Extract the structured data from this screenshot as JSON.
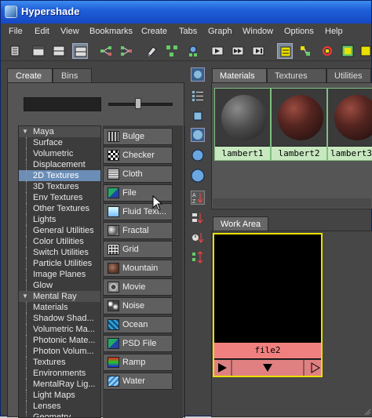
{
  "window": {
    "title": "Hypershade"
  },
  "menubar": {
    "items": [
      "File",
      "Edit",
      "View",
      "Bookmarks",
      "Create",
      "Tabs",
      "Graph",
      "Window",
      "Options",
      "Help"
    ]
  },
  "left_tabs": [
    "Create",
    "Bins"
  ],
  "tree": {
    "maya": {
      "label": "Maya",
      "items": [
        "Surface",
        "Volumetric",
        "Displacement",
        "2D Textures",
        "3D Textures",
        "Env Textures",
        "Other Textures",
        "Lights",
        "General Utilities",
        "Color Utilities",
        "Switch Utilities",
        "Particle Utilities",
        "Image Planes",
        "Glow"
      ],
      "selected": "2D Textures"
    },
    "mental_ray": {
      "label": "Mental Ray",
      "items": [
        "Materials",
        "Shadow Shad...",
        "Volumetric Ma...",
        "Photonic Mate...",
        "Photon Volum...",
        "Textures",
        "Environments",
        "MentalRay Lig...",
        "Light Maps",
        "Lenses",
        "Geometry"
      ]
    }
  },
  "nodes": [
    {
      "label": "Bulge",
      "icon": "bulge-texture-icon"
    },
    {
      "label": "Checker",
      "icon": "checker-texture-icon"
    },
    {
      "label": "Cloth",
      "icon": "cloth-texture-icon"
    },
    {
      "label": "File",
      "icon": "file-texture-icon"
    },
    {
      "label": "Fluid Text...",
      "icon": "fluid-texture-icon"
    },
    {
      "label": "Fractal",
      "icon": "fractal-texture-icon"
    },
    {
      "label": "Grid",
      "icon": "grid-texture-icon"
    },
    {
      "label": "Mountain",
      "icon": "mountain-texture-icon"
    },
    {
      "label": "Movie",
      "icon": "movie-texture-icon"
    },
    {
      "label": "Noise",
      "icon": "noise-texture-icon"
    },
    {
      "label": "Ocean",
      "icon": "ocean-texture-icon"
    },
    {
      "label": "PSD File",
      "icon": "psd-file-texture-icon"
    },
    {
      "label": "Ramp",
      "icon": "ramp-texture-icon"
    },
    {
      "label": "Water",
      "icon": "water-texture-icon"
    }
  ],
  "right_tabs": [
    "Materials",
    "Textures",
    "Utilities"
  ],
  "materials": [
    "lambert1",
    "lambert2",
    "lambert3"
  ],
  "work_area": {
    "tab": "Work Area",
    "node_label": "file2"
  },
  "colors": {
    "title_bar": "#1f5fd8",
    "panel_bg": "#444444",
    "tree_selection": "#6b8eb7",
    "swatch_caption": "#c8e8c0",
    "node_outline": "#e8e000",
    "node_label_bg": "#f08080"
  }
}
